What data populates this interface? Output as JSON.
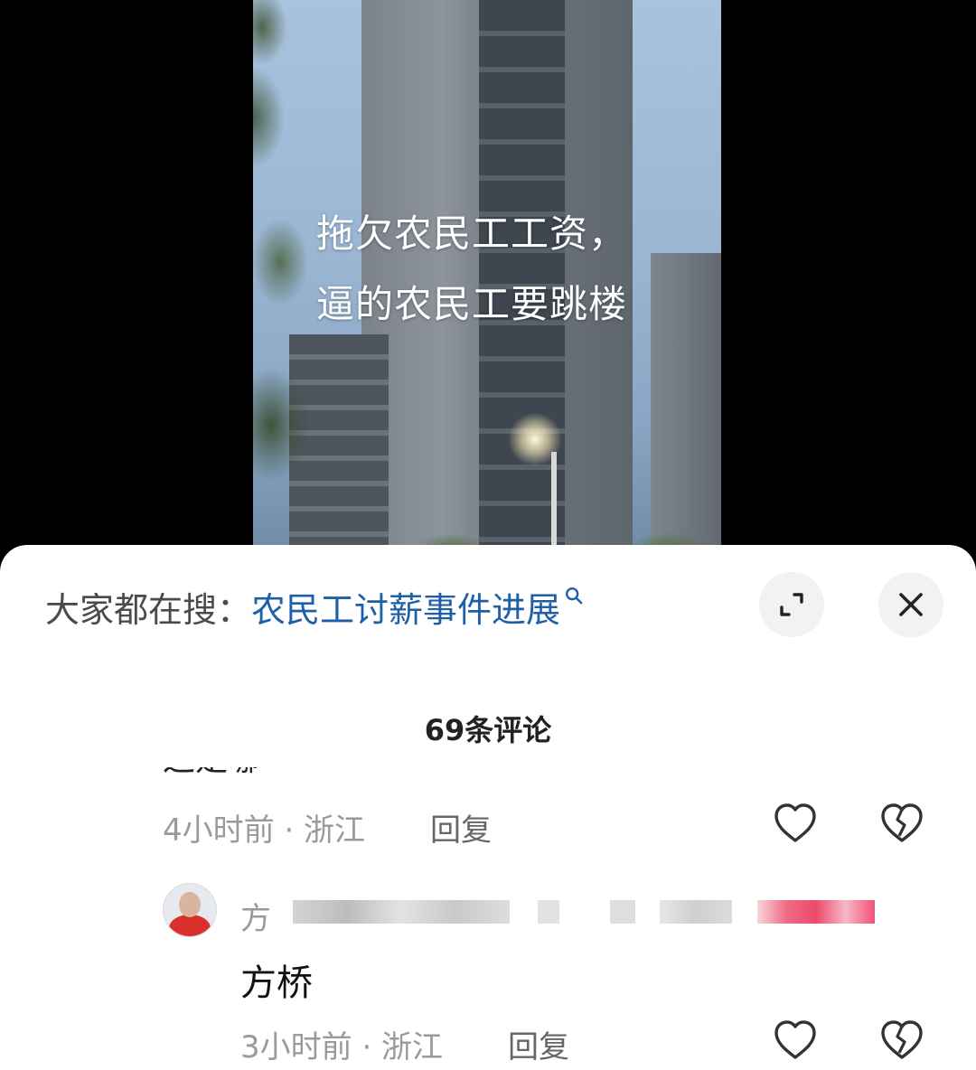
{
  "video": {
    "caption_lines": [
      "拖欠农民工工资，",
      "逼的农民工要跳楼"
    ]
  },
  "search": {
    "label": "大家都在搜：",
    "query": "农民工讨薪事件进展",
    "icon": "search-icon"
  },
  "header": {
    "expand_icon": "expand-icon",
    "close_icon": "close-icon"
  },
  "comments_count": "69条评论",
  "comments": [
    {
      "text_cut": "这是哪",
      "time_location": "4小时前 · 浙江",
      "reply_label": "回复",
      "like_icon": "heart-icon",
      "dislike_icon": "broken-heart-icon"
    },
    {
      "username_prefix": "方",
      "text": "方桥",
      "time_location": "3小时前 · 浙江",
      "reply_label": "回复",
      "like_icon": "heart-icon",
      "dislike_icon": "broken-heart-icon"
    }
  ],
  "colors": {
    "link": "#1e5fa8",
    "meta": "#9a9a9a",
    "sheet_bg": "#ffffff"
  }
}
